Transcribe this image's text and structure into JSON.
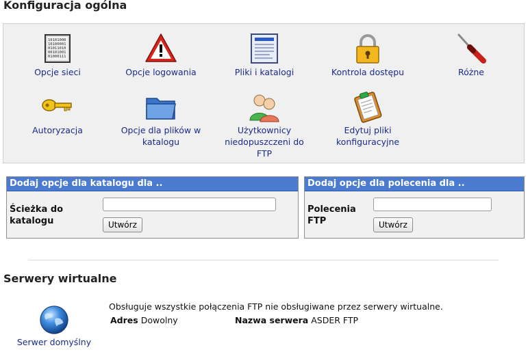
{
  "general": {
    "title": "Konfiguracja ogólna",
    "icons": [
      {
        "label": "Opcje sieci",
        "icon": "network-binary-icon"
      },
      {
        "label": "Opcje logowania",
        "icon": "warning-icon"
      },
      {
        "label": "Pliki i katalogi",
        "icon": "document-icon"
      },
      {
        "label": "Kontrola dostępu",
        "icon": "padlock-icon"
      },
      {
        "label": "Różne",
        "icon": "screwdriver-icon"
      },
      {
        "label": "Autoryzacja",
        "icon": "key-icon"
      },
      {
        "label": "Opcje dla plików w katalogu",
        "icon": "folder-icon"
      },
      {
        "label": "Użytkownicy niedopuszczeni do FTP",
        "icon": "users-icon"
      },
      {
        "label": "Edytuj pliki konfiguracyjne",
        "icon": "clipboard-edit-icon"
      }
    ]
  },
  "dir_form": {
    "header": "Dodaj opcje dla katalogu dla ..",
    "label": "Ścieżka do katalogu",
    "input_value": "",
    "button": "Utwórz"
  },
  "cmd_form": {
    "header": "Dodaj opcje dla polecenia dla ..",
    "label": "Polecenia FTP",
    "input_value": "",
    "button": "Utwórz"
  },
  "virtual": {
    "title": "Serwery wirtualne",
    "description": "Obsługuje wszystkie połączenia FTP nie obsługiwane przez serwery wirtualne.",
    "address_label": "Adres",
    "address_value": "Dowolny",
    "server_name_label": "Nazwa serwera",
    "server_name_value": "ASDER FTP",
    "server_label": "Serwer domyślny",
    "server_icon": "globe-icon"
  },
  "colors": {
    "header_bg": "#4a7bd1",
    "link": "#1a2a8c",
    "panel_bg": "#f0f0f0"
  }
}
